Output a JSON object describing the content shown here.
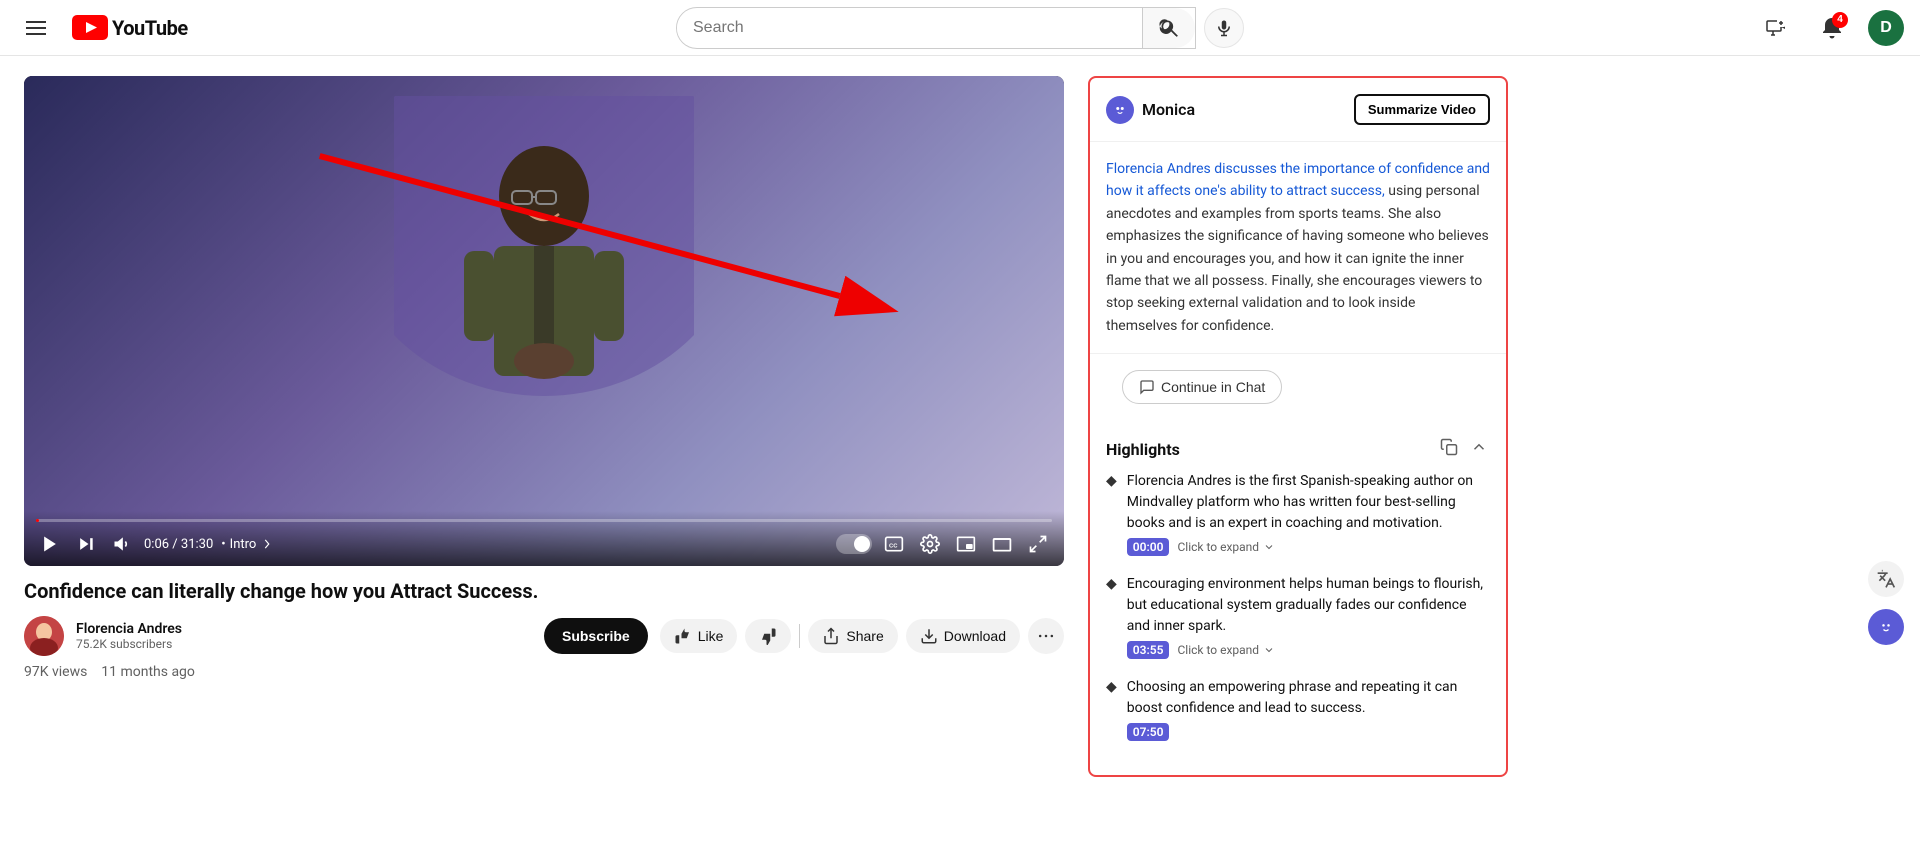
{
  "nav": {
    "hamburger_label": "Menu",
    "logo_text": "YouTube",
    "search_placeholder": "Search",
    "search_btn_label": "Search",
    "mic_label": "Search with your voice",
    "create_btn_label": "Create",
    "notifications_label": "Notifications",
    "notifications_count": "4",
    "avatar_letter": "D"
  },
  "video": {
    "title": "Confidence can literally change how you Attract Success.",
    "time_current": "0:06",
    "time_total": "31:30",
    "chapter": "Intro",
    "views": "97K views",
    "uploaded": "11 months ago",
    "channel_name": "Florencia Andres",
    "subscriber_count": "75.2K subscribers",
    "subscribe_label": "Subscribe",
    "like_label": "Like",
    "dislike_label": "Dislike",
    "share_label": "Share",
    "download_label": "Download",
    "more_label": "More"
  },
  "monica": {
    "name": "Monica",
    "summarize_btn": "Summarize Video",
    "summary": "Florencia Andres discusses the importance of confidence and how it affects one's ability to attract success, using personal anecdotes and examples from sports teams. She also emphasizes the significance of having someone who believes in you and encourages you, and how it can ignite the inner flame that we all possess. Finally, she encourages viewers to stop seeking external validation and to look inside themselves for confidence.",
    "continue_chat_label": "Continue in Chat",
    "highlights_title": "Highlights",
    "highlights": [
      {
        "text": "Florencia Andres is the first Spanish-speaking author on Mindvalley platform who has written four best-selling books and is an expert in coaching and motivation.",
        "timestamp": "00:00",
        "expand_label": "Click to expand"
      },
      {
        "text": "Encouraging environment helps human beings to flourish, but educational system gradually fades our confidence and inner spark.",
        "timestamp": "03:55",
        "expand_label": "Click to expand"
      },
      {
        "text": "Choosing an empowering phrase and repeating it can boost confidence and lead to success.",
        "timestamp": "07:50",
        "expand_label": ""
      }
    ]
  },
  "icons": {
    "search": "🔍",
    "mic": "🎤",
    "create": "➕",
    "bell": "🔔",
    "play": "▶",
    "skip_next": "⏭",
    "volume": "🔊",
    "subtitles": "CC",
    "settings": "⚙",
    "miniplayer": "⧉",
    "theater": "▬",
    "fullscreen": "⛶",
    "like": "👍",
    "dislike": "👎",
    "share": "↗",
    "download": "⬇",
    "copy": "⧉",
    "collapse": "⌃",
    "chat": "💬",
    "translate": "A",
    "help": "?"
  }
}
